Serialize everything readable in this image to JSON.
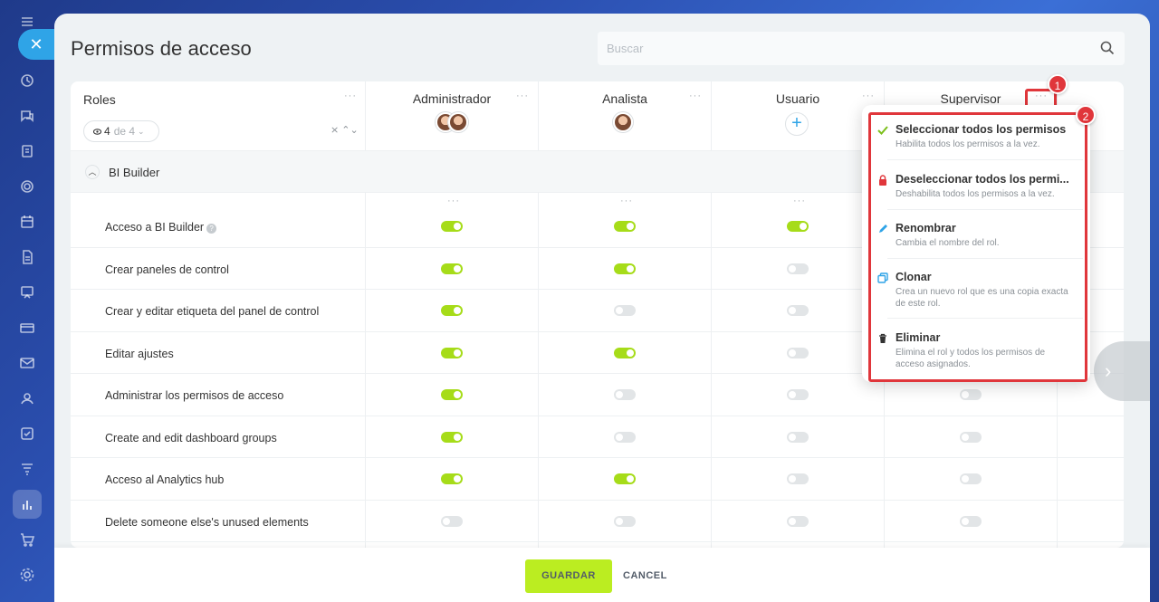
{
  "page": {
    "title": "Permisos de acceso",
    "search_placeholder": "Buscar"
  },
  "table": {
    "roles_header": "Roles",
    "filter": {
      "count": "4",
      "of_label": "de 4"
    },
    "columns": [
      {
        "label": "Administrador",
        "members": 2
      },
      {
        "label": "Analista",
        "members": 1
      },
      {
        "label": "Usuario",
        "members": 0
      },
      {
        "label": "Supervisor",
        "members": 0
      }
    ],
    "section": {
      "title": "BI Builder",
      "expanded": true
    },
    "rows": [
      {
        "label": "Acceso a BI Builder",
        "help": true,
        "values": [
          true,
          true,
          true,
          null
        ]
      },
      {
        "label": "Crear paneles de control",
        "values": [
          true,
          true,
          false,
          null
        ]
      },
      {
        "label": "Crear y editar etiqueta del panel de control",
        "values": [
          true,
          false,
          false,
          null
        ]
      },
      {
        "label": "Editar ajustes",
        "values": [
          true,
          true,
          false,
          null
        ]
      },
      {
        "label": "Administrar los permisos de acceso",
        "values": [
          true,
          false,
          false,
          false
        ]
      },
      {
        "label": "Create and edit dashboard groups",
        "values": [
          true,
          false,
          false,
          false
        ]
      },
      {
        "label": "Acceso al Analytics hub",
        "values": [
          true,
          true,
          false,
          false
        ]
      },
      {
        "label": "Delete someone else's unused elements",
        "values": [
          false,
          false,
          false,
          false
        ]
      }
    ]
  },
  "menu": {
    "items": [
      {
        "title": "Seleccionar todos los permisos",
        "desc": "Habilita todos los permisos a la vez.",
        "icon": "check-icon"
      },
      {
        "title": "Deseleccionar todos los permi...",
        "desc": "Deshabilita todos los permisos a la vez.",
        "icon": "lock-icon"
      },
      {
        "title": "Renombrar",
        "desc": "Cambia el nombre del rol.",
        "icon": "pencil-icon"
      },
      {
        "title": "Clonar",
        "desc": "Crea un nuevo rol que es una copia exacta de este rol.",
        "icon": "clone-icon"
      },
      {
        "title": "Eliminar",
        "desc": "Elimina el rol y todos los permisos de acceso asignados.",
        "icon": "trash-icon"
      }
    ]
  },
  "callouts": [
    "1",
    "2"
  ],
  "footer": {
    "save": "GUARDAR",
    "cancel": "CANCEL"
  },
  "colors": {
    "toggle_on": "#a6dc19",
    "toggle_off": "#e2e5e7",
    "save_button": "#bbed21",
    "highlight": "#e0363b",
    "accent": "#2fa4e7"
  }
}
